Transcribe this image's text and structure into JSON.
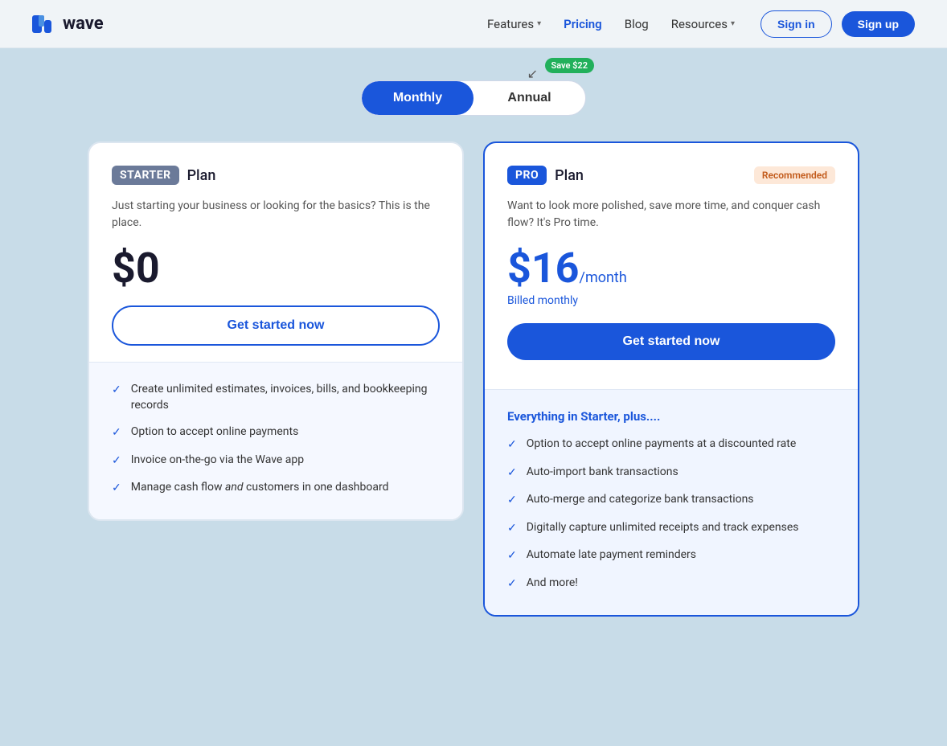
{
  "header": {
    "logo_text": "wave",
    "nav": [
      {
        "label": "Features",
        "has_dropdown": true,
        "active": false
      },
      {
        "label": "Pricing",
        "has_dropdown": false,
        "active": true
      },
      {
        "label": "Blog",
        "has_dropdown": false,
        "active": false
      },
      {
        "label": "Resources",
        "has_dropdown": true,
        "active": false
      }
    ],
    "signin_label": "Sign in",
    "signup_label": "Sign up"
  },
  "toggle": {
    "save_badge": "Save $22",
    "monthly_label": "Monthly",
    "annual_label": "Annual",
    "active": "monthly"
  },
  "starter": {
    "badge": "STARTER",
    "plan_label": "Plan",
    "description": "Just starting your business or looking for the basics? This is the place.",
    "price": "$0",
    "cta": "Get started now",
    "features": [
      "Create unlimited estimates, invoices, bills, and bookkeeping records",
      "Option to accept online payments",
      "Invoice on-the-go via the Wave app",
      "Manage cash flow and customers in one dashboard"
    ]
  },
  "pro": {
    "badge": "PRO",
    "plan_label": "Plan",
    "recommended_label": "Recommended",
    "description": "Want to look more polished, save more time, and conquer cash flow? It's Pro time.",
    "price": "$16",
    "price_per": "/month",
    "billing_label": "Billed monthly",
    "cta": "Get started now",
    "features_title": "Everything in Starter, plus....",
    "features": [
      "Option to accept online payments at a discounted rate",
      "Auto-import bank transactions",
      "Auto-merge and categorize bank transactions",
      "Digitally capture unlimited receipts and track expenses",
      "Automate late payment reminders",
      "And more!"
    ]
  }
}
